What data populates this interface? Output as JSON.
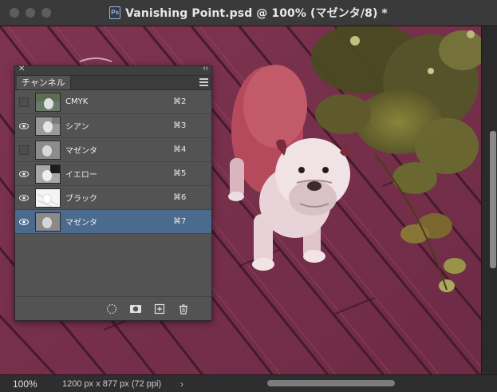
{
  "window": {
    "title": "Vanishing Point.psd @ 100% (マゼンタ/8) *"
  },
  "panel": {
    "tab_label": "チャンネル",
    "channels": [
      {
        "name": "CMYK",
        "shortcut": "⌘2",
        "visible": false
      },
      {
        "name": "シアン",
        "shortcut": "⌘3",
        "visible": true
      },
      {
        "name": "マゼンタ",
        "shortcut": "⌘4",
        "visible": false
      },
      {
        "name": "イエロー",
        "shortcut": "⌘5",
        "visible": true
      },
      {
        "name": "ブラック",
        "shortcut": "⌘6",
        "visible": true
      },
      {
        "name": "マゼンタ",
        "shortcut": "⌘7",
        "visible": true,
        "selected": true
      }
    ]
  },
  "status": {
    "zoom": "100%",
    "doc_info": "1200 px x 877 px (72 ppi)",
    "arrow": "›"
  },
  "icons": {
    "load_selection": "dotted-circle-icon",
    "save_mask": "mask-icon",
    "new_channel": "plus-square-icon",
    "delete_channel": "trash-icon"
  },
  "colors": {
    "selected_row": "#4a6a8e",
    "deck": "#8a3a52",
    "panel_bg": "#535353"
  }
}
